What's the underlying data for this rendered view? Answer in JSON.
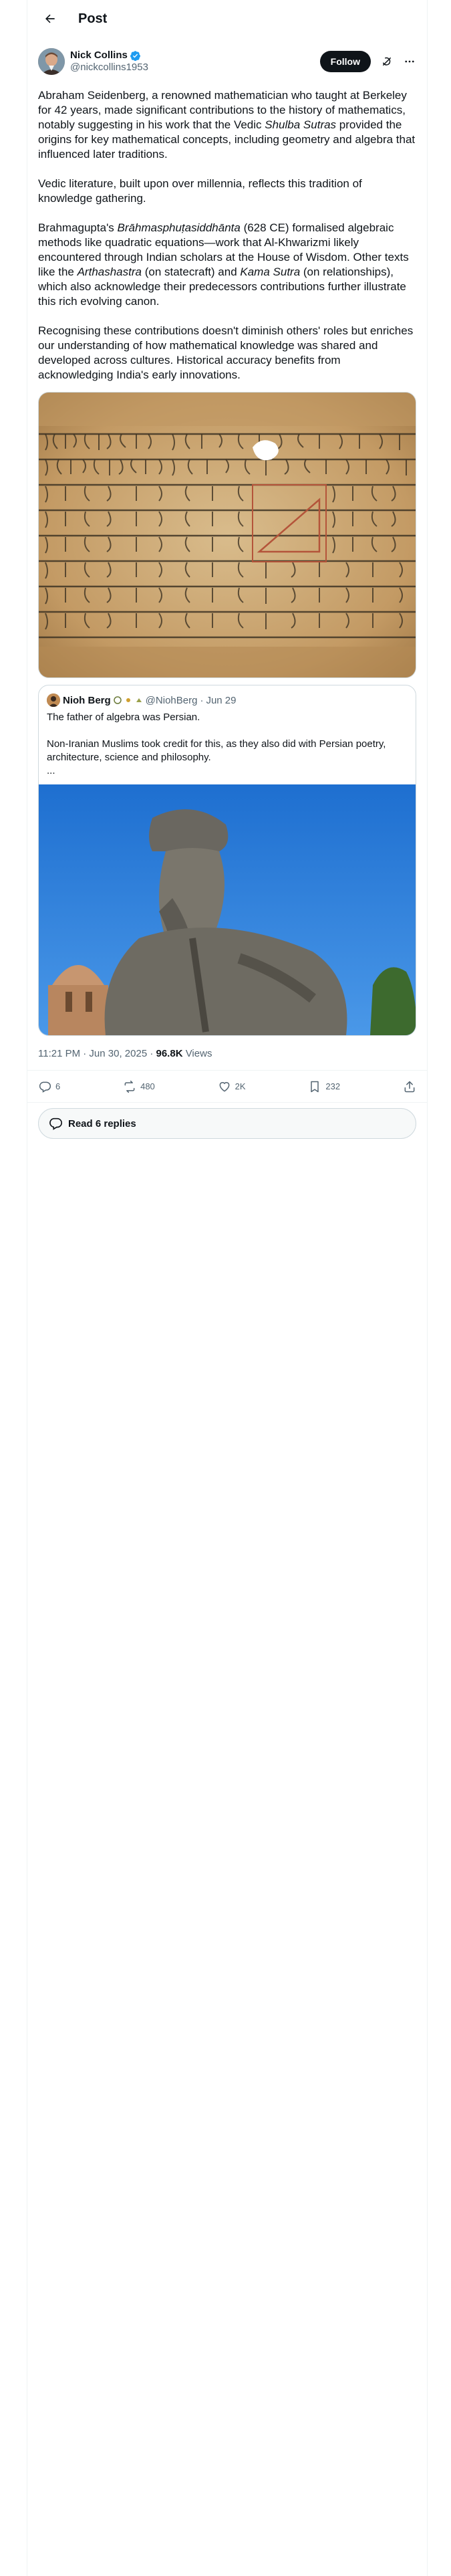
{
  "header": {
    "title": "Post"
  },
  "author": {
    "display_name": "Nick Collins",
    "handle": "@nickcollins1953",
    "follow_label": "Follow"
  },
  "post": {
    "paragraphs": [
      "Abraham Seidenberg, a renowned mathematician who taught at Berkeley for 42 years, made significant contributions to the history of mathematics, notably suggesting in his work that the Vedic Shulba Sutras provided the origins for key mathematical concepts, including geometry and algebra that influenced later traditions.",
      "Vedic literature, built upon over millennia, reflects this tradition of knowledge gathering.",
      "Brahmagupta's Brāhmasphuṭasiddhānta (628 CE) formalised algebraic methods like quadratic equations—work that Al-Khwarizmi likely encountered through Indian scholars at the House of Wisdom. Other texts like the Arthashastra (on statecraft) and Kama Sutra (on relationships), which also acknowledge their predecessors contributions further illustrate this rich evolving canon.",
      "Recognising these contributions doesn't diminish others' roles but enriches our understanding of how mathematical knowledge was shared and developed across cultures. Historical accuracy benefits from acknowledging India's early innovations."
    ],
    "inline": {
      "p1_a": "Abraham Seidenberg, a renowned mathematician who taught at Berkeley for 42 years, made significant contributions to the history of mathematics, notably suggesting in his work that the Vedic ",
      "p1_i": "Shulba Sutras",
      "p1_b": " provided the origins for key mathematical concepts, including geometry and algebra that influenced later traditions.",
      "p3_a": "Brahmagupta's ",
      "p3_i1": "Brāhmasphuṭasiddhānta",
      "p3_b": " (628 CE) formalised algebraic methods like quadratic equations—work that Al-Khwarizmi likely encountered through Indian scholars at the House of Wisdom. Other texts like the ",
      "p3_i2": "Arthashastra",
      "p3_c": " (on statecraft) and ",
      "p3_i3": "Kama Sutra",
      "p3_d": " (on relationships), which also acknowledge their predecessors contributions further illustrate this rich evolving canon."
    }
  },
  "quote": {
    "display_name": "Nioh Berg",
    "handle": "@NiohBerg",
    "separator": "·",
    "date": "Jun 29",
    "text_1": "The father of algebra was Persian.",
    "text_2": "Non-Iranian Muslims took credit for this, as they also did with Persian poetry, architecture, science and philosophy.",
    "ellipsis": "..."
  },
  "meta": {
    "time": "11:21 PM · Jun 30, 2025 · ",
    "views_count": "96.8K",
    "views_label": " Views"
  },
  "actions": {
    "replies": "6",
    "reposts": "480",
    "likes": "2K",
    "bookmarks": "232"
  },
  "read_replies_label": "Read 6 replies",
  "colors": {
    "accent": "#1d9bf0",
    "text": "#0f1419",
    "muted": "#536471",
    "border": "#cfd9de"
  }
}
